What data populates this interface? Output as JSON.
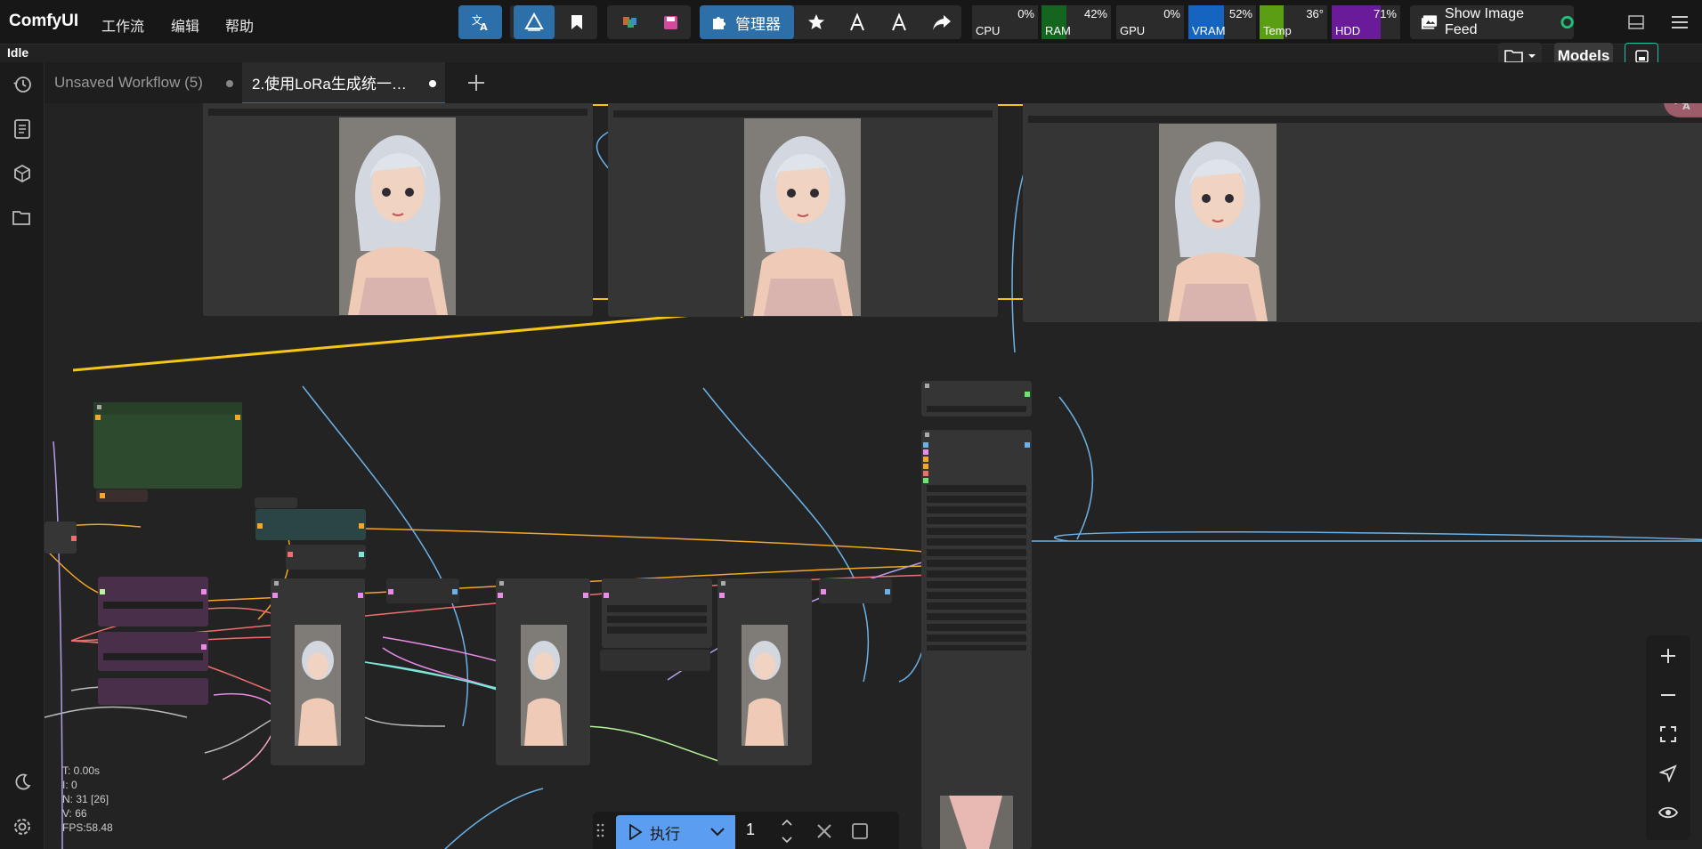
{
  "brand": "ComfyUI",
  "menu": [
    "工作流",
    "编辑",
    "帮助"
  ],
  "toolbar": {
    "manager_label": "管理器",
    "show_image_feed": "Show Image Feed",
    "models_label": "Models"
  },
  "stats": [
    {
      "label": "CPU",
      "value": "0%",
      "color": "#2b2b2b",
      "level": 0
    },
    {
      "label": "RAM",
      "value": "42%",
      "color": "#14651e",
      "level": 0.42
    },
    {
      "label": "GPU",
      "value": "0%",
      "color": "#2b2b2b",
      "level": 0
    },
    {
      "label": "VRAM",
      "value": "52%",
      "color": "#1565c0",
      "level": 0.52
    },
    {
      "label": "Temp",
      "value": "36°",
      "color": "#5a9e12",
      "level": 0.36
    },
    {
      "label": "HDD",
      "value": "71%",
      "color": "#6a1b9a",
      "level": 0.71
    }
  ],
  "status": "Idle",
  "tabs": [
    {
      "label": "Unsaved Workflow (5)",
      "active": false
    },
    {
      "label": "2.使用LoRa生成统一…",
      "active": true
    }
  ],
  "run": {
    "label": "执行",
    "count": "1"
  },
  "canvas_stats": [
    "T: 0.00s",
    "I: 0",
    "N: 31 [26]",
    "V: 66",
    "FPS:58.48"
  ],
  "colors": {
    "accent": "#2d6fa8",
    "highlight": "#f5c518",
    "node": "#353535",
    "canvas": "#232323"
  },
  "icons": [
    "translate-icon",
    "workflow-icon",
    "bookmark-icon",
    "palette-icon",
    "save-icon",
    "puzzle-icon",
    "star-icon",
    "export-icon",
    "share-icon",
    "image-feed-icon",
    "panel-icon",
    "hamburger-icon",
    "folder-icon",
    "history-icon",
    "queue-icon",
    "model-library-icon",
    "node-library-icon",
    "moon-icon",
    "settings-icon",
    "zoom-in-icon",
    "zoom-out-icon",
    "fit-view-icon",
    "select-icon",
    "visibility-icon"
  ]
}
